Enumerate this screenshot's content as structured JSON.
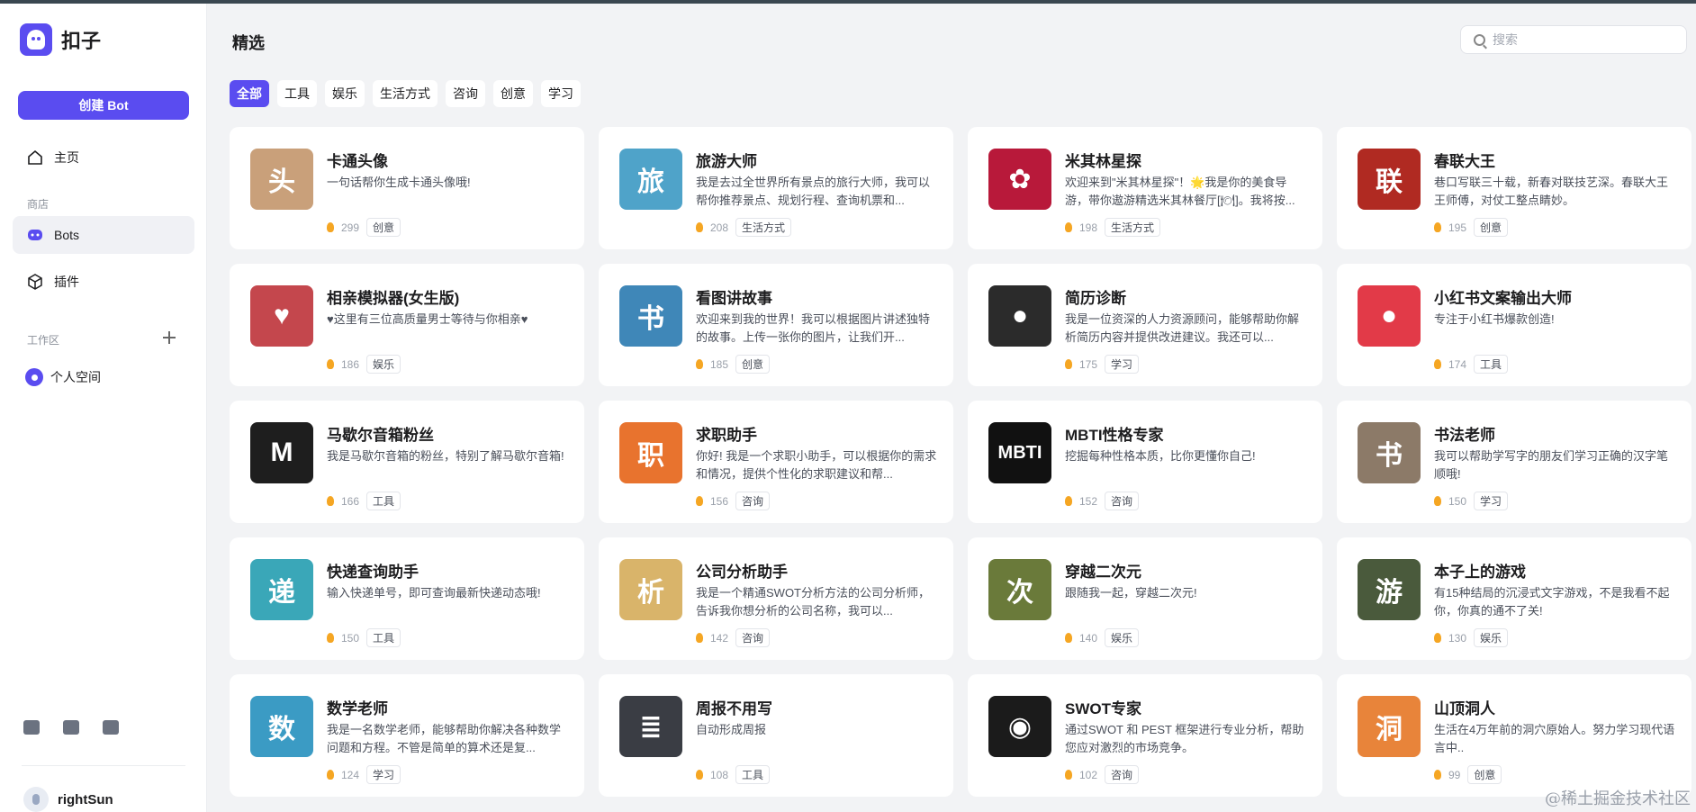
{
  "app": {
    "name": "扣子"
  },
  "sidebar": {
    "create_label": "创建 Bot",
    "home_label": "主页",
    "store_label": "商店",
    "items": [
      {
        "label": "Bots"
      },
      {
        "label": "插件"
      }
    ],
    "workspace_label": "工作区",
    "personal_space_label": "个人空间",
    "user_name": "rightSun"
  },
  "header": {
    "title": "精选",
    "search_placeholder": "搜索"
  },
  "filters": [
    "全部",
    "工具",
    "娱乐",
    "生活方式",
    "咨询",
    "创意",
    "学习"
  ],
  "active_filter": "全部",
  "cards": [
    {
      "title": "卡通头像",
      "desc": "一句话帮你生成卡通头像哦!",
      "count": "299",
      "tag": "创意",
      "thumb": "头",
      "color": "#c9a07a"
    },
    {
      "title": "旅游大师",
      "desc": "我是去过全世界所有景点的旅行大师，我可以帮你推荐景点、规划行程、查询机票和...",
      "count": "208",
      "tag": "生活方式",
      "thumb": "旅",
      "color": "#4fa3c9"
    },
    {
      "title": "米其林星探",
      "desc": "欢迎来到\"米其林星探\"！🌟我是你的美食导游，带你遨游精选米其林餐厅[🍽]。我将按...",
      "count": "198",
      "tag": "生活方式",
      "thumb": "✿",
      "color": "#b8193a"
    },
    {
      "title": "春联大王",
      "desc": "巷口写联三十载，新春对联技艺深。春联大王王师傅，对仗工整点睛妙。",
      "count": "195",
      "tag": "创意",
      "thumb": "联",
      "color": "#b02a22"
    },
    {
      "title": "相亲模拟器(女生版)",
      "desc": "♥这里有三位高质量男士等待与你相亲♥",
      "count": "186",
      "tag": "娱乐",
      "thumb": "♥",
      "color": "#c4474d"
    },
    {
      "title": "看图讲故事",
      "desc": "欢迎来到我的世界！我可以根据图片讲述独特的故事。上传一张你的图片，让我们开...",
      "count": "185",
      "tag": "创意",
      "thumb": "书",
      "color": "#3f87b8"
    },
    {
      "title": "简历诊断",
      "desc": "我是一位资深的人力资源顾问，能够帮助你解析简历内容并提供改进建议。我还可以...",
      "count": "175",
      "tag": "学习",
      "thumb": "●",
      "color": "#2b2b2b"
    },
    {
      "title": "小红书文案输出大师",
      "desc": "专注于小红书爆款创造!",
      "count": "174",
      "tag": "工具",
      "thumb": "●",
      "color": "#e23a48"
    },
    {
      "title": "马歇尔音箱粉丝",
      "desc": "我是马歇尔音箱的粉丝，特别了解马歇尔音箱!",
      "count": "166",
      "tag": "工具",
      "thumb": "M",
      "color": "#1e1e1e"
    },
    {
      "title": "求职助手",
      "desc": "你好! 我是一个求职小助手，可以根据你的需求和情况，提供个性化的求职建议和帮...",
      "count": "156",
      "tag": "咨询",
      "thumb": "职",
      "color": "#e8732e"
    },
    {
      "title": "MBTI性格专家",
      "desc": "挖掘每种性格本质，比你更懂你自己!",
      "count": "152",
      "tag": "咨询",
      "thumb": "MBTI",
      "color": "#111111"
    },
    {
      "title": "书法老师",
      "desc": "我可以帮助学写字的朋友们学习正确的汉字笔顺哦!",
      "count": "150",
      "tag": "学习",
      "thumb": "书",
      "color": "#8c7a68"
    },
    {
      "title": "快递查询助手",
      "desc": "输入快递单号，即可查询最新快递动态哦!",
      "count": "150",
      "tag": "工具",
      "thumb": "递",
      "color": "#3aa7b8"
    },
    {
      "title": "公司分析助手",
      "desc": "我是一个精通SWOT分析方法的公司分析师，告诉我你想分析的公司名称，我可以...",
      "count": "142",
      "tag": "咨询",
      "thumb": "析",
      "color": "#d9b46a"
    },
    {
      "title": "穿越二次元",
      "desc": "跟随我一起，穿越二次元!",
      "count": "140",
      "tag": "娱乐",
      "thumb": "次",
      "color": "#6a7a3a"
    },
    {
      "title": "本子上的游戏",
      "desc": "有15种结局的沉浸式文字游戏，不是我看不起你，你真的通不了关!",
      "count": "130",
      "tag": "娱乐",
      "thumb": "游",
      "color": "#4a5a3c"
    },
    {
      "title": "数学老师",
      "desc": "我是一名数学老师，能够帮助你解决各种数学问题和方程。不管是简单的算术还是复...",
      "count": "124",
      "tag": "学习",
      "thumb": "数",
      "color": "#3b9bc4"
    },
    {
      "title": "周报不用写",
      "desc": "自动形成周报",
      "count": "108",
      "tag": "工具",
      "thumb": "≣",
      "color": "#3a3d44"
    },
    {
      "title": "SWOT专家",
      "desc": "通过SWOT 和 PEST 框架进行专业分析，帮助您应对激烈的市场竞争。",
      "count": "102",
      "tag": "咨询",
      "thumb": "◉",
      "color": "#1b1b1b"
    },
    {
      "title": "山顶洞人",
      "desc": "生活在4万年前的洞穴原始人。努力学习现代语言中..",
      "count": "99",
      "tag": "创意",
      "thumb": "洞",
      "color": "#e8843a"
    }
  ],
  "watermark": "@稀土掘金技术社区"
}
